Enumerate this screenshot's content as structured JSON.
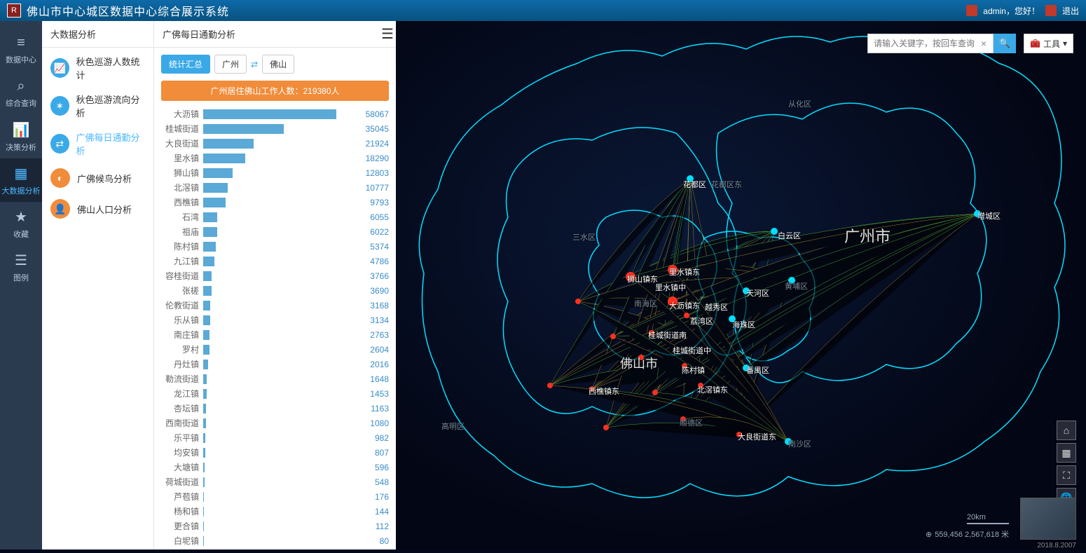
{
  "header": {
    "title": "佛山市中心城区数据中心综合展示系统",
    "user_greeting": "admin，您好！",
    "logout": "退出"
  },
  "left_nav": [
    {
      "icon": "≡",
      "label": "数据中心"
    },
    {
      "icon": "⌕",
      "label": "综合查询"
    },
    {
      "icon": "📊",
      "label": "决策分析"
    },
    {
      "icon": "▦",
      "label": "大数据分析",
      "active": true
    },
    {
      "icon": "★",
      "label": "收藏"
    },
    {
      "icon": "☰",
      "label": "图例"
    }
  ],
  "panel": {
    "breadcrumb1": "大数据分析",
    "breadcrumb2": "广佛每日通勤分析",
    "sub_items": [
      {
        "label": "秋色巡游人数统计",
        "color": "blue",
        "icon": "📈"
      },
      {
        "label": "秋色巡游流向分析",
        "color": "blue",
        "icon": "✶"
      },
      {
        "label": "广佛每日通勤分析",
        "color": "blue",
        "icon": "⇄",
        "active": true
      },
      {
        "label": "广佛候鸟分析",
        "color": "orange",
        "icon": "◐"
      },
      {
        "label": "佛山人口分析",
        "color": "orange",
        "icon": "👤"
      }
    ],
    "tabs": {
      "summary": "统计汇总",
      "city1": "广州",
      "city2": "佛山"
    },
    "banner": "广州居住佛山工作人数：219380人"
  },
  "search": {
    "placeholder": "请输入关键字，按回车查询"
  },
  "tools": {
    "label": "工具"
  },
  "scale": {
    "label": "20km"
  },
  "coords": {
    "text": "559,456 2,567,618 米"
  },
  "date": "2018.8.2007",
  "map_labels": {
    "guangzhou": "广州市",
    "foshan": "佛山市",
    "baiyun": "白云区",
    "tianhe": "天河区",
    "haizhu": "海珠区",
    "panyu": "番禺区",
    "huadu": "花都区",
    "huadu_east": "花都区东",
    "conghua": "从化区",
    "zengcheng": "增城区",
    "nansha": "南沙区",
    "sanshui": "三水区",
    "nanhai": "南海区",
    "gaoming": "高明区",
    "shunde": "顺德区",
    "dali": "大沥镇东",
    "lishui_dong": "里水镇东",
    "lishui_zhong": "里水镇中",
    "shishan": "狮山镇东",
    "xiqiao": "西樵镇东",
    "beijiao": "北滘镇东",
    "chencun": "陈村镇",
    "daliang": "大良街道东",
    "guicheng": "桂城街道南",
    "guicheng2": "桂城街道中",
    "yuexiu": "越秀区",
    "liwan": "荔湾区",
    "huangpu": "黄埔区"
  },
  "chart_data": {
    "type": "bar",
    "title": "广州居住佛山工作人数：219380人",
    "xlabel": "",
    "ylabel": "",
    "xlim": [
      0,
      60000
    ],
    "categories": [
      "大沥镇",
      "桂城街道",
      "大良街道",
      "里水镇",
      "狮山镇",
      "北滘镇",
      "西樵镇",
      "石湾",
      "祖庙",
      "陈村镇",
      "九江镇",
      "容桂街道",
      "张槎",
      "伦教街道",
      "乐从镇",
      "南庄镇",
      "罗村",
      "丹灶镇",
      "勒流街道",
      "龙江镇",
      "杏坛镇",
      "西南街道",
      "乐平镇",
      "均安镇",
      "大塘镇",
      "荷城街道",
      "芦苞镇",
      "杨和镇",
      "更合镇",
      "白坭镇"
    ],
    "values": [
      58067,
      35045,
      21924,
      18290,
      12803,
      10777,
      9793,
      6055,
      6022,
      5374,
      4786,
      3766,
      3690,
      3168,
      3134,
      2763,
      2604,
      2016,
      1648,
      1453,
      1163,
      1080,
      982,
      807,
      596,
      548,
      176,
      144,
      112,
      80
    ]
  }
}
